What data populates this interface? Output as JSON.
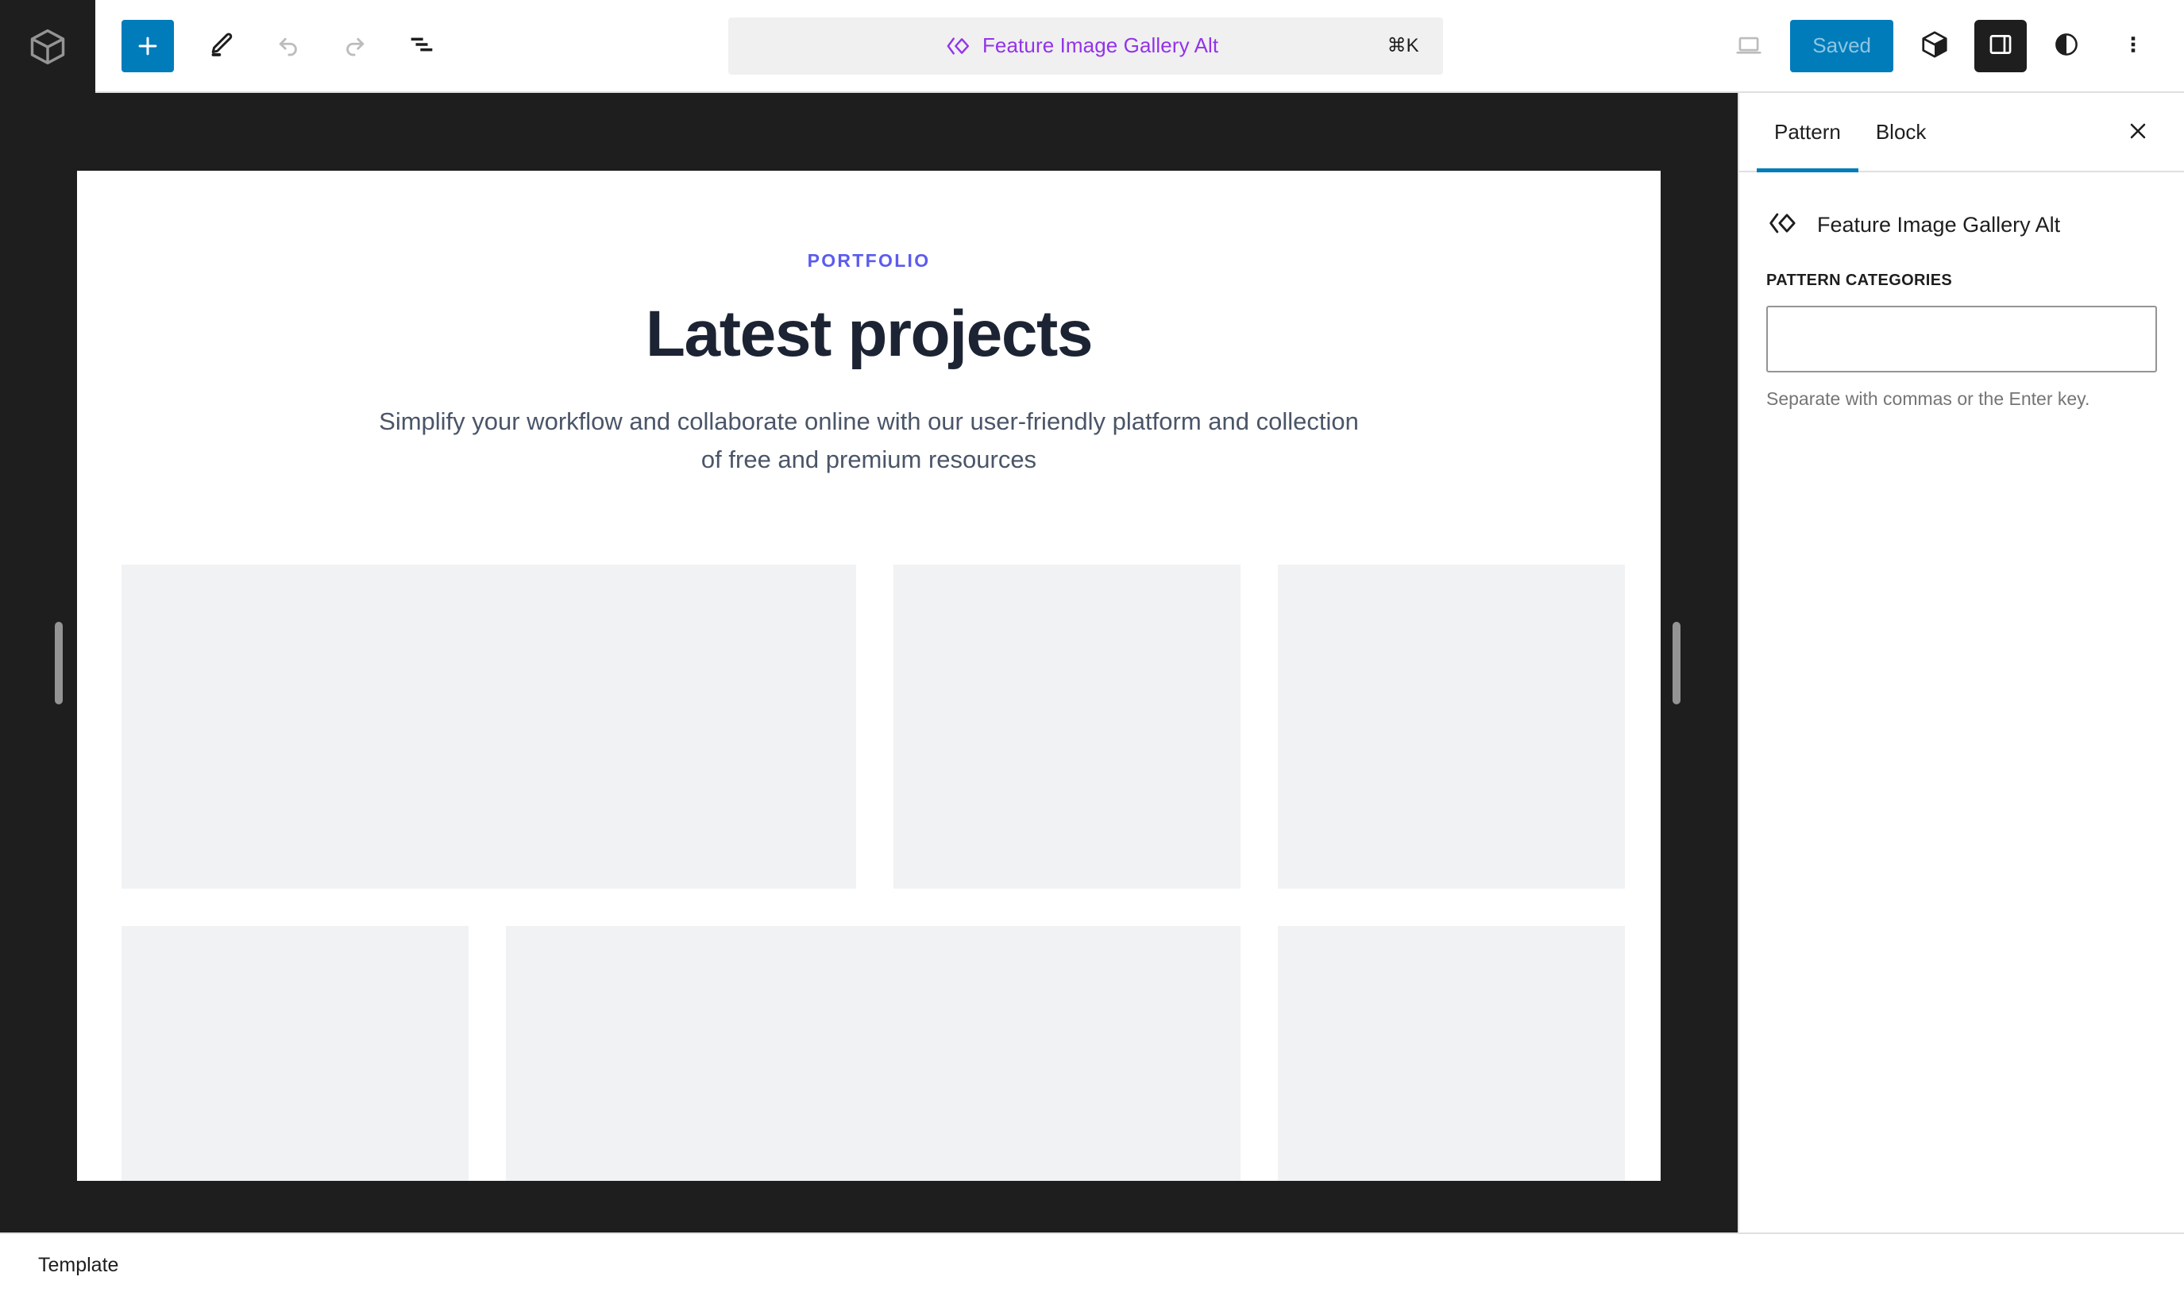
{
  "header": {
    "site_hub_icon": "block-cube-icon",
    "toolbar_left": [
      {
        "name": "add-block-button",
        "icon": "plus-icon",
        "label": "Add block",
        "state": "primary"
      },
      {
        "name": "edit-mode-button",
        "icon": "pencil-icon",
        "label": "Edit",
        "state": "normal"
      },
      {
        "name": "undo-button",
        "icon": "undo-arrow-icon",
        "label": "Undo",
        "state": "disabled"
      },
      {
        "name": "redo-button",
        "icon": "redo-arrow-icon",
        "label": "Redo",
        "state": "disabled"
      },
      {
        "name": "list-view-button",
        "icon": "list-view-icon",
        "label": "Document Overview",
        "state": "normal"
      }
    ],
    "command_bar": {
      "icon": "pattern-chevron-diamond-icon",
      "title": "Feature Image Gallery Alt",
      "shortcut": "⌘K"
    },
    "toolbar_right": {
      "device_icon": "desktop-preview-icon",
      "save_label": "Saved",
      "block_inserter_icon": "styles-cube-icon",
      "sidebar_toggle_icon": "settings-sidebar-icon",
      "styles_icon": "contrast-circle-icon",
      "options_icon": "three-dots-vertical-icon"
    }
  },
  "canvas": {
    "resize_handle_left": "resize-handle-left",
    "resize_handle_right": "resize-handle-right",
    "page": {
      "eyebrow": "PORTFOLIO",
      "headline": "Latest projects",
      "subcopy": "Simplify your workflow and collaborate online with our user-friendly platform and collection of free and premium resources",
      "gallery": {
        "row1": [
          "image-placeholder-1",
          "image-placeholder-2",
          "image-placeholder-3"
        ],
        "row2": [
          "image-placeholder-4",
          "image-placeholder-5",
          "image-placeholder-6"
        ]
      }
    }
  },
  "sidebar": {
    "tabs": [
      {
        "label": "Pattern",
        "active": true
      },
      {
        "label": "Block",
        "active": false
      }
    ],
    "close_label": "Close Settings",
    "pattern": {
      "icon": "pattern-chevron-diamond-icon",
      "title": "Feature Image Gallery Alt"
    },
    "categories_field": {
      "label": "Pattern Categories",
      "value": "",
      "placeholder": "",
      "help": "Separate with commas or the Enter key."
    }
  },
  "footer": {
    "breadcrumb": "Template"
  },
  "colors": {
    "accent_blue": "#007cba",
    "dark_chrome": "#1e1e1e",
    "command_purple": "#9333ea",
    "eyebrow_indigo": "#5b5bf0",
    "headline_navy": "#1c2434",
    "placeholder_grey": "#f1f2f4"
  }
}
